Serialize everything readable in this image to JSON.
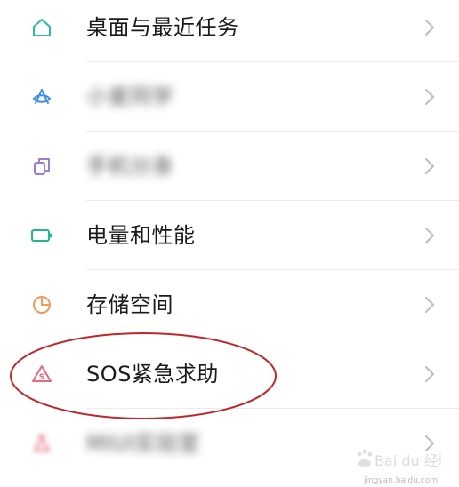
{
  "settings_list": {
    "items": [
      {
        "label": "桌面与最近任务",
        "icon": "home-icon",
        "blurred": false
      },
      {
        "label": "小爱同学",
        "icon": "assistant-icon",
        "blurred": true
      },
      {
        "label": "手机分身",
        "icon": "dual-phone-icon",
        "blurred": true
      },
      {
        "label": "电量和性能",
        "icon": "battery-icon",
        "blurred": false
      },
      {
        "label": "存储空间",
        "icon": "storage-pie-icon",
        "blurred": false
      },
      {
        "label": "SOS紧急求助",
        "icon": "sos-alert-icon",
        "blurred": false
      },
      {
        "label": "MIUI实验室",
        "icon": "lab-icon",
        "blurred": true
      }
    ]
  },
  "colors": {
    "icon_teal": "#2fb8a8",
    "icon_blue": "#3a8ee6",
    "icon_purple": "#9c7bd6",
    "icon_green": "#22b58e",
    "icon_orange": "#f09a5a",
    "icon_red": "#e26a7a",
    "chevron": "#bdbdbd",
    "annotation_red": "#c0272d"
  },
  "watermark": {
    "brand": "Bai du 经验",
    "sub": "jingyan.baidu.com"
  }
}
